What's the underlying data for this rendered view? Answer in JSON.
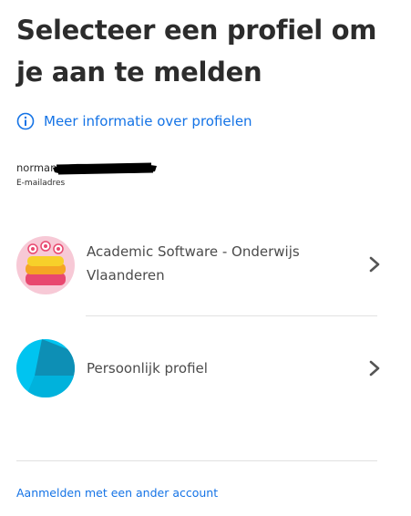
{
  "header": {
    "title": "Selecteer een profiel om je aan te melden"
  },
  "info_link": {
    "label": "Meer informatie over profielen",
    "icon": "info-icon"
  },
  "account": {
    "email_visible": "norman",
    "email_label": "E-mailadres",
    "redacted": true
  },
  "profiles": [
    {
      "label": "Academic Software - Onderwijs Vlaanderen",
      "avatar_icon": "cake-monster-avatar",
      "chevron_icon": "chevron-right-icon"
    },
    {
      "label": "Persoonlijk profiel",
      "avatar_icon": "personal-profile-avatar",
      "chevron_icon": "chevron-right-icon"
    }
  ],
  "footer": {
    "alt_account_label": "Aanmelden met een ander account"
  },
  "colors": {
    "link": "#1473e6",
    "title": "#2c2c2c",
    "personal_avatar_bg": "#00c4f0",
    "personal_avatar_shape": "#0d8fb5",
    "academic_avatar_bg": "#f7c9d6"
  }
}
